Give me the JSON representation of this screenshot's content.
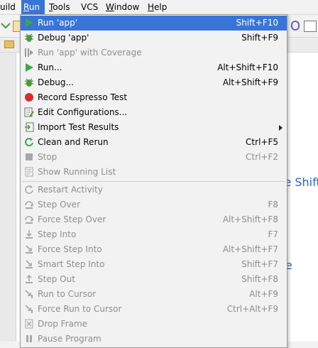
{
  "menubar": {
    "items": [
      {
        "label": "uild",
        "ul": ""
      },
      {
        "label": "Run",
        "ul": "R",
        "rest": "un"
      },
      {
        "label": "Tools",
        "ul": "T",
        "rest": "ools"
      },
      {
        "label": "VCS",
        "ul": "",
        "rest": "VCS"
      },
      {
        "label": "Window",
        "ul": "W",
        "rest": "indow"
      },
      {
        "label": "Help",
        "ul": "H",
        "rest": "elp"
      }
    ]
  },
  "editor": {
    "hint1": "le Shift",
    "hint2": "e"
  },
  "menu": {
    "items": [
      {
        "label": "Run 'app'",
        "shortcut": "Shift+F10",
        "icon": "run-icon"
      },
      {
        "label": "Debug 'app'",
        "shortcut": "Shift+F9",
        "icon": "debug-icon"
      },
      {
        "label": "Run 'app' with Coverage",
        "shortcut": "",
        "icon": "coverage-icon"
      },
      {
        "label": "Run...",
        "shortcut": "Alt+Shift+F10",
        "icon": "run-icon"
      },
      {
        "label": "Debug...",
        "shortcut": "Alt+Shift+F9",
        "icon": "debug-icon"
      },
      {
        "label": "Record Espresso Test",
        "shortcut": "",
        "icon": "record-icon"
      },
      {
        "label": "Edit Configurations...",
        "shortcut": "",
        "icon": "edit-config-icon"
      },
      {
        "label": "Import Test Results",
        "shortcut": "",
        "icon": "import-icon"
      },
      {
        "label": "Clean and Rerun",
        "shortcut": "Ctrl+F5",
        "icon": "clean-rerun-icon"
      },
      {
        "label": "Stop",
        "shortcut": "Ctrl+F2",
        "icon": "stop-icon"
      },
      {
        "label": "Show Running List",
        "shortcut": "",
        "icon": "running-list-icon"
      },
      {
        "label": "Restart Activity",
        "shortcut": "",
        "icon": "restart-icon"
      },
      {
        "label": "Step Over",
        "shortcut": "F8",
        "icon": "step-over-icon"
      },
      {
        "label": "Force Step Over",
        "shortcut": "Alt+Shift+F8",
        "icon": "force-step-over-icon"
      },
      {
        "label": "Step Into",
        "shortcut": "F7",
        "icon": "step-into-icon"
      },
      {
        "label": "Force Step Into",
        "shortcut": "Alt+Shift+F7",
        "icon": "force-step-into-icon"
      },
      {
        "label": "Smart Step Into",
        "shortcut": "Shift+F7",
        "icon": "smart-step-into-icon"
      },
      {
        "label": "Step Out",
        "shortcut": "Shift+F8",
        "icon": "step-out-icon"
      },
      {
        "label": "Run to Cursor",
        "shortcut": "Alt+F9",
        "icon": "run-to-cursor-icon"
      },
      {
        "label": "Force Run to Cursor",
        "shortcut": "Ctrl+Alt+F9",
        "icon": "force-run-to-cursor-icon"
      },
      {
        "label": "Drop Frame",
        "shortcut": "",
        "icon": "drop-frame-icon"
      },
      {
        "label": "Pause Program",
        "shortcut": "",
        "icon": "pause-icon"
      }
    ]
  },
  "colors": {
    "highlight": "#3875d7",
    "run_green": "#3aa843",
    "record_red": "#d92b2b",
    "disabled": "#8e8e8e"
  }
}
